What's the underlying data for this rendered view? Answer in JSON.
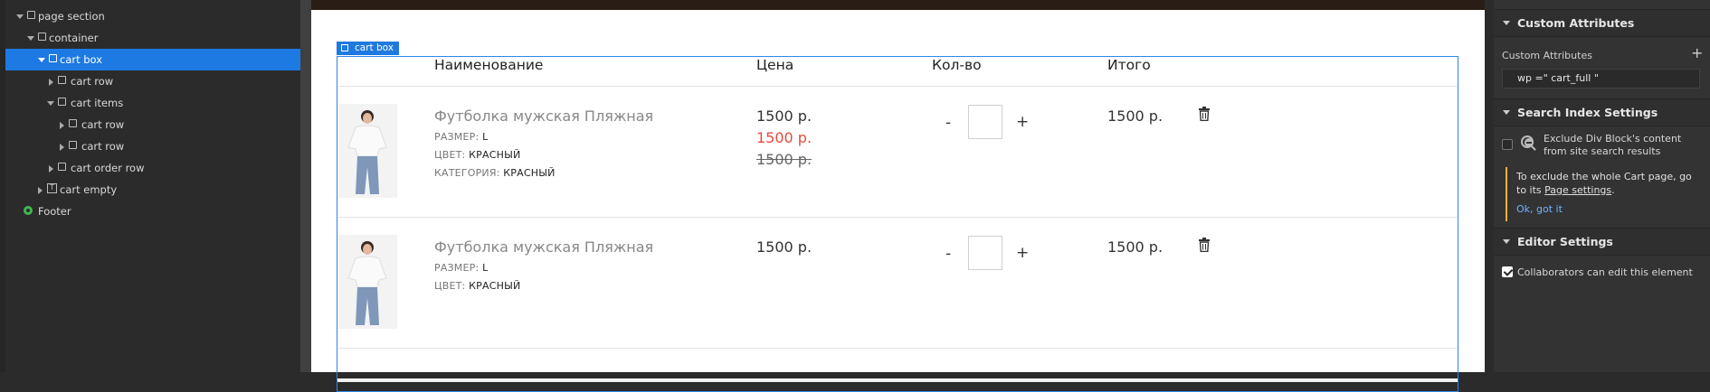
{
  "navigator": {
    "items": [
      {
        "label": "page section",
        "icon": "box-icon",
        "caret": "down"
      },
      {
        "label": "container",
        "icon": "box-icon",
        "caret": "down"
      },
      {
        "label": "cart box",
        "icon": "box-icon",
        "caret": "down",
        "selected": true
      },
      {
        "label": "cart row",
        "icon": "box-icon",
        "caret": "right"
      },
      {
        "label": "cart items",
        "icon": "box-icon",
        "caret": "down"
      },
      {
        "label": "cart row",
        "icon": "box-icon",
        "caret": "right"
      },
      {
        "label": "cart row",
        "icon": "box-icon",
        "caret": "right"
      },
      {
        "label": "cart order row",
        "icon": "box-icon",
        "caret": "right"
      },
      {
        "label": "cart empty",
        "icon": "symbol-icon",
        "caret": "right"
      },
      {
        "label": "Footer",
        "icon": "symbol-gear-icon",
        "caret": "none"
      }
    ]
  },
  "canvas": {
    "selection_tag": "cart box",
    "headers": {
      "name": "Наименование",
      "price": "Цена",
      "qty": "Кол-во",
      "total": "Итого"
    },
    "rows": [
      {
        "name": "Футболка мужская Пляжная",
        "attrs": [
          {
            "key": "РАЗМЕР:",
            "value": "L"
          },
          {
            "key": "ЦВЕТ:",
            "value": "КРАСНЫЙ"
          },
          {
            "key": "КАТЕГОРИЯ:",
            "value": "КРАСНЫЙ"
          }
        ],
        "price": "1500 р.",
        "price_sale": "1500 р.",
        "price_old": "1500 р.",
        "qty_minus": "-",
        "qty_plus": "+",
        "total": "1500 р."
      },
      {
        "name": "Футболка мужская Пляжная",
        "attrs": [
          {
            "key": "РАЗМЕР:",
            "value": "L"
          },
          {
            "key": "ЦВЕТ:",
            "value": "КРАСНЫЙ"
          }
        ],
        "price": "1500 р.",
        "qty_minus": "-",
        "qty_plus": "+",
        "total": "1500 р."
      }
    ],
    "colors": {
      "selection": "#1f7ae0",
      "sale_price": "#e34b3e"
    }
  },
  "panel": {
    "custom_attributes": {
      "title": "Custom Attributes",
      "label": "Custom Attributes",
      "add": "+",
      "value": "wp =\" cart_full \""
    },
    "search_index": {
      "title": "Search Index Settings",
      "checkbox_label": "Exclude Div Block's content from site search results",
      "note_prefix": "To exclude the whole Cart page, go to its ",
      "note_link": "Page settings",
      "note_suffix": ".",
      "ok": "Ok, got it"
    },
    "editor": {
      "title": "Editor Settings",
      "checkbox_label": "Collaborators can edit this element",
      "checked": true
    }
  }
}
